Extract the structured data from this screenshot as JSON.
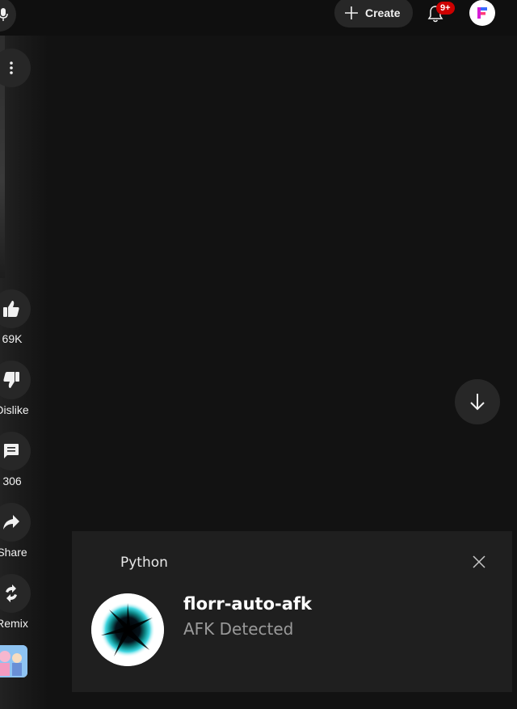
{
  "header": {
    "create_label": "Create",
    "notification_count": "9+"
  },
  "actions": {
    "like_count": "69K",
    "dislike_label": "Dislike",
    "comment_count": "306",
    "share_label": "Share",
    "remix_label": "Remix"
  },
  "notification": {
    "app_name": "Python",
    "title": "florr-auto-afk",
    "body": "AFK Detected"
  },
  "colors": {
    "background": "#0f0f0f",
    "button_bg": "#272727",
    "badge": "#cc0000",
    "toast_bg": "#1f1f1f"
  },
  "icons": [
    "mic-icon",
    "plus-icon",
    "bell-icon",
    "avatar-logo-icon",
    "more-vert-icon",
    "thumb-up-icon",
    "thumb-down-icon",
    "comment-icon",
    "share-icon",
    "remix-icon",
    "arrow-down-icon",
    "close-icon"
  ]
}
